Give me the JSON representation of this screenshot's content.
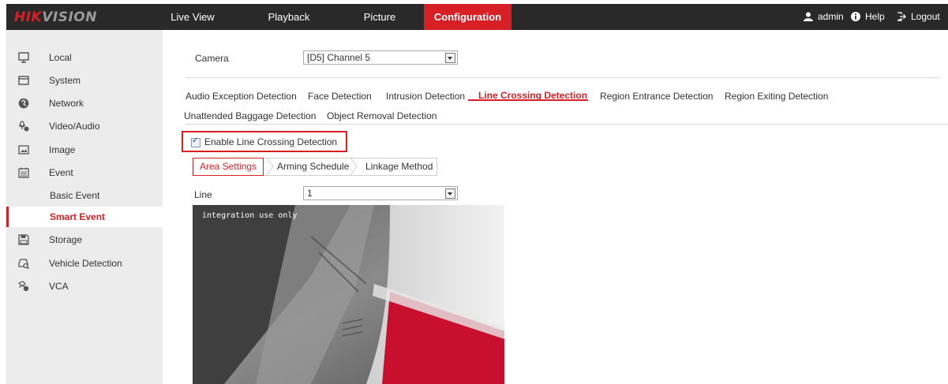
{
  "header": {
    "logo_hik": "HIK",
    "logo_vision": "VISION",
    "nav": [
      "Live View",
      "Playback",
      "Picture",
      "Configuration"
    ],
    "active_nav": "Configuration",
    "user": "admin",
    "help": "Help",
    "logout": "Logout"
  },
  "sidebar": {
    "items": [
      {
        "label": "Local",
        "icon": "monitor-icon"
      },
      {
        "label": "System",
        "icon": "system-icon"
      },
      {
        "label": "Network",
        "icon": "network-icon"
      },
      {
        "label": "Video/Audio",
        "icon": "video-audio-icon"
      },
      {
        "label": "Image",
        "icon": "image-icon"
      },
      {
        "label": "Event",
        "icon": "event-icon"
      },
      {
        "label": "Storage",
        "icon": "storage-icon"
      },
      {
        "label": "Vehicle Detection",
        "icon": "vehicle-icon"
      },
      {
        "label": "VCA",
        "icon": "vca-icon"
      }
    ],
    "event_sub": [
      "Basic Event",
      "Smart Event"
    ],
    "active_sub": "Smart Event"
  },
  "main": {
    "camera_label": "Camera",
    "camera_value": "[D5] Channel 5",
    "tabs_row1": [
      "Audio Exception Detection",
      "Face Detection",
      "Intrusion Detection",
      "Line Crossing Detection",
      "Region Entrance Detection",
      "Region Exiting Detection"
    ],
    "tabs_row2": [
      "Unattended Baggage Detection",
      "Object Removal Detection"
    ],
    "active_tab": "Line Crossing Detection",
    "enable_label": "Enable Line Crossing Detection",
    "enable_checked": true,
    "subtabs": [
      "Area Settings",
      "Arming Schedule",
      "Linkage Method"
    ],
    "active_subtab": "Area Settings",
    "line_label": "Line",
    "line_value": "1",
    "video_overlay": "integration use only"
  },
  "colors": {
    "accent": "#d71f26",
    "topbar": "#292929",
    "sidebar": "#ececec"
  }
}
